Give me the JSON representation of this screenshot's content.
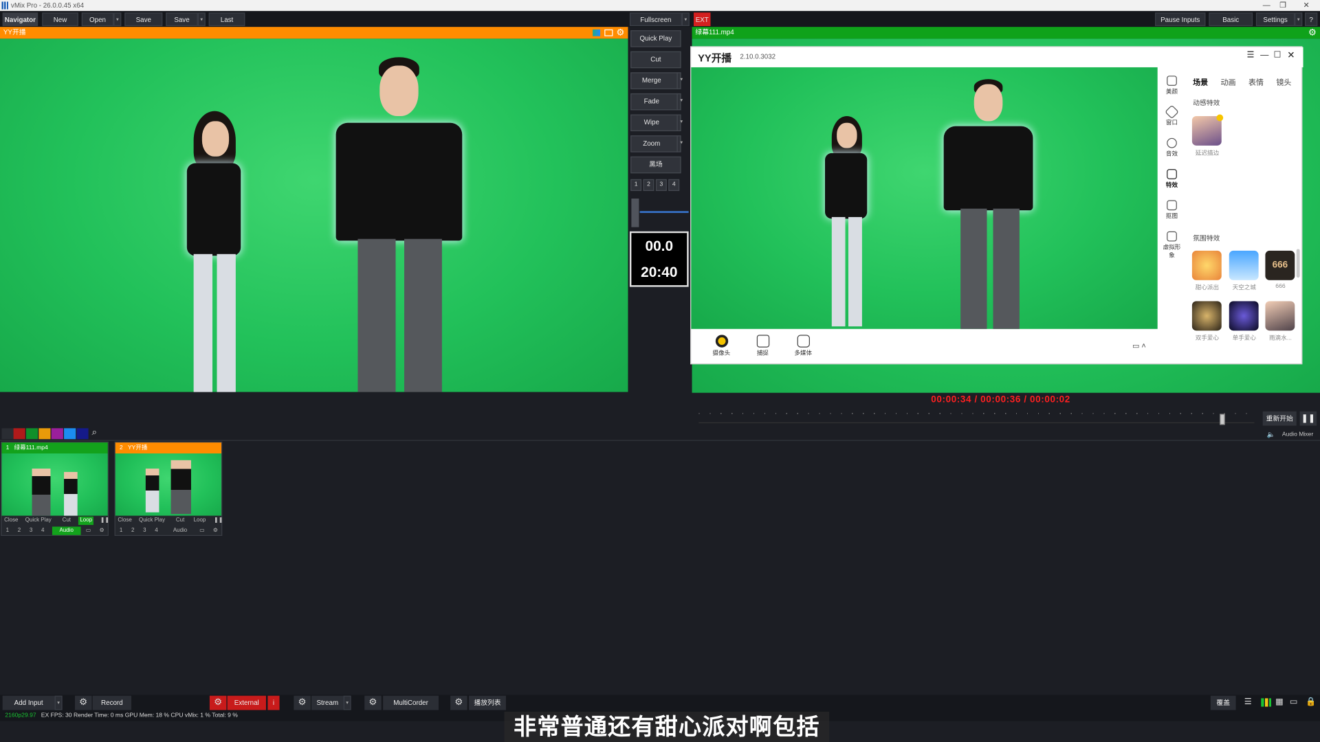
{
  "app": {
    "title": "vMix Pro - 26.0.0.45 x64"
  },
  "toolbar": {
    "navigator": "Navigator",
    "new": "New",
    "open": "Open",
    "save1": "Save",
    "save2": "Save",
    "last": "Last",
    "fullscreen": "Fullscreen",
    "ext": "EXT",
    "pause_inputs": "Pause Inputs",
    "basic": "Basic",
    "settings": "Settings",
    "help": "?"
  },
  "preview": {
    "title": "YY开播"
  },
  "output": {
    "title": "绿幕111.mp4"
  },
  "transitions": {
    "quick_play": "Quick Play",
    "cut": "Cut",
    "merge": "Merge",
    "fade": "Fade",
    "wipe": "Wipe",
    "zoom": "Zoom",
    "black": "黑场",
    "nums": [
      "1",
      "2",
      "3",
      "4"
    ]
  },
  "clock": {
    "line1": "00.0",
    "line2": "20:40"
  },
  "yy": {
    "name": "YY开播",
    "version": "2.10.0.3032",
    "side": [
      "美颜",
      "窗口",
      "音效",
      "特效",
      "抠图",
      "虚拟形象"
    ],
    "tabs": [
      "场景",
      "动画",
      "表情",
      "镜头"
    ],
    "sec1": "动感特效",
    "fx1": "延迟描边",
    "sec2": "氛围特效",
    "fx_row1": [
      "甜心派出",
      "天空之城",
      "666"
    ],
    "fx_row2": [
      "双手爱心",
      "单手爱心",
      "雨滴水..."
    ],
    "bottom": [
      "摄像头",
      "捕捉",
      "多媒体"
    ]
  },
  "playback": {
    "timecode": "00:00:34  /  00:00:36  /  00:00:02",
    "restart": "重新开始",
    "audio_mixer": "Audio Mixer"
  },
  "inputs": [
    {
      "num": "1",
      "name": "绿幕111.mp4",
      "header_color": "#13a21c",
      "controls": [
        "Close",
        "Quick Play",
        "Cut",
        "Loop"
      ],
      "nums": [
        "1",
        "2",
        "3",
        "4"
      ],
      "audio": "Audio"
    },
    {
      "num": "2",
      "name": "YY开播",
      "header_color": "#ff8c00",
      "controls": [
        "Close",
        "Quick Play",
        "Cut",
        "Loop"
      ],
      "nums": [
        "1",
        "2",
        "3",
        "4"
      ],
      "audio": "Audio"
    }
  ],
  "bottom": {
    "add_input": "Add Input",
    "record": "Record",
    "external": "External",
    "ext_i": "i",
    "stream": "Stream",
    "multicorder": "MultiCorder",
    "playlist": "播放列表",
    "overlay": "覆盖"
  },
  "status": {
    "format": "2160p29.97",
    "text": "EX  FPS: 30  Render Time: 0 ms  GPU Mem: 18 %  CPU vMix: 1 %  Total: 9 %"
  },
  "subtitle": "非常普通还有甜心派对啊包括",
  "colors": {
    "accent_orange": "#ff8c00",
    "accent_green": "#13a21c",
    "bg": "#1c1e24",
    "timecode": "#ff2020"
  }
}
